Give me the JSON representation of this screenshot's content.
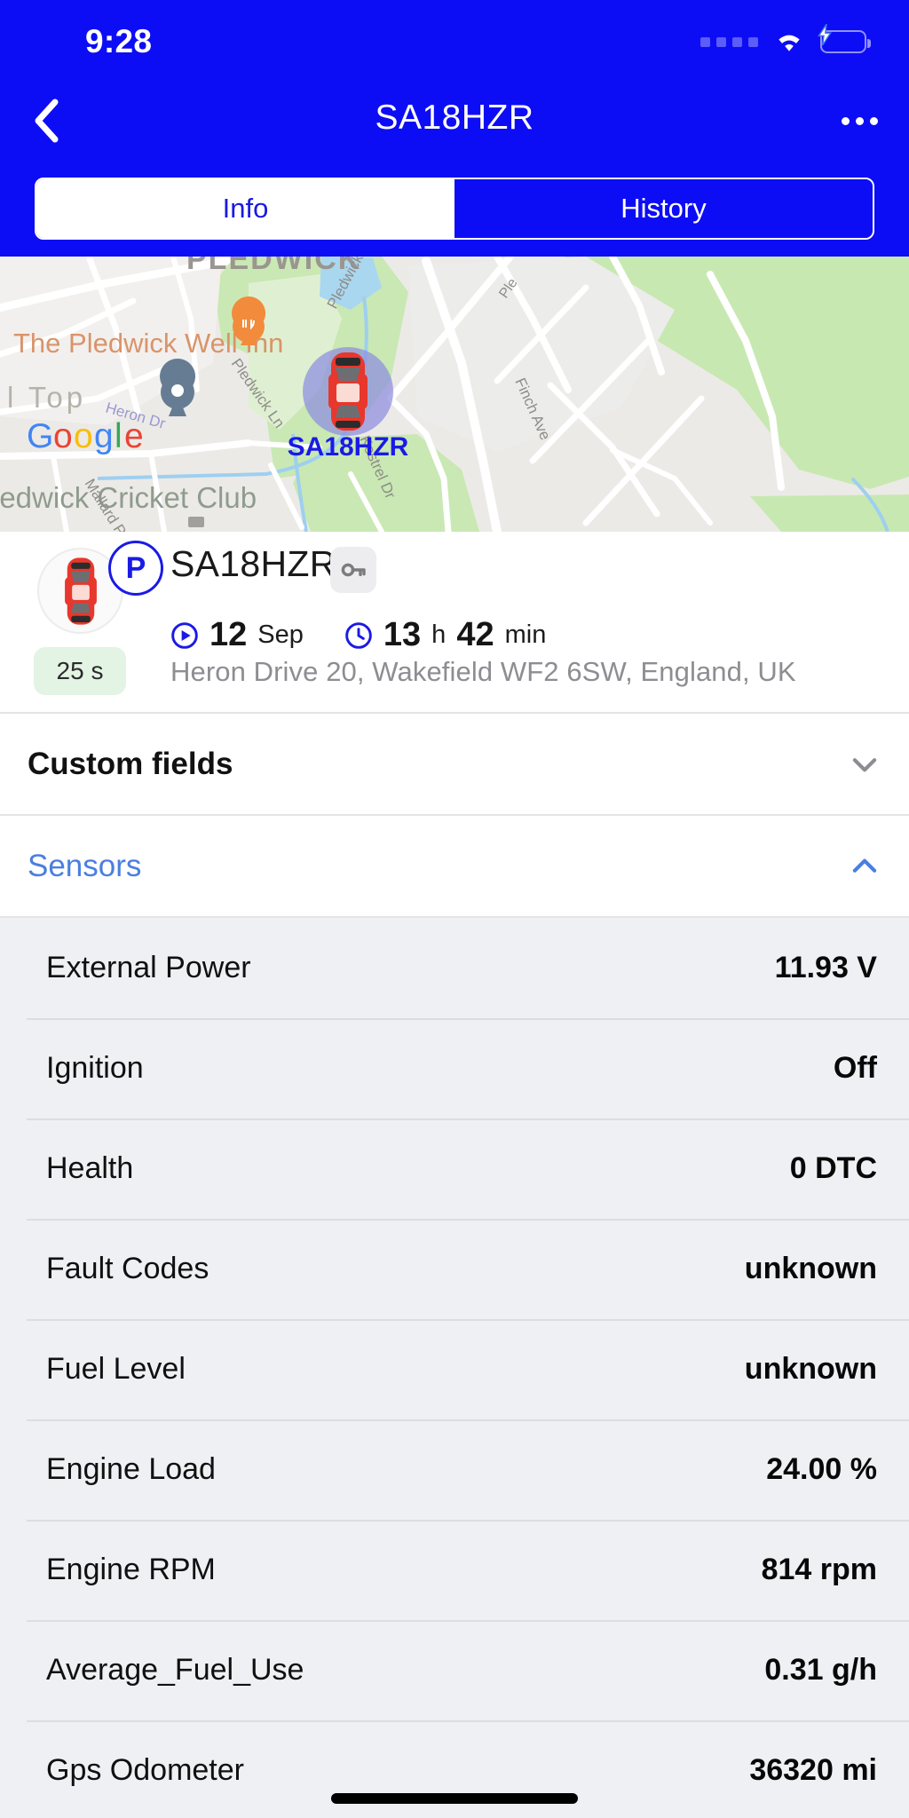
{
  "statusbar": {
    "time": "9:28",
    "signal_icon": "signal-dots-icon",
    "wifi_icon": "wifi-icon",
    "battery_icon": "battery-charging-icon"
  },
  "header": {
    "back_icon": "chevron-left-icon",
    "title": "SA18HZR",
    "more_icon": "more-horizontal-icon",
    "accent_color": "#0d0df5"
  },
  "tabs": [
    {
      "label": "Info",
      "active": true
    },
    {
      "label": "History",
      "active": false
    }
  ],
  "map": {
    "provider_logo": "google-logo",
    "provider_name": "Google",
    "marker_label": "SA18HZR",
    "marker_icon": "car-top-view-icon",
    "poi": [
      {
        "name": "The Pledwick Well Inn",
        "icon": "restaurant-pin-icon"
      },
      {
        "name": "Pledwick Cricket Club",
        "icon": "place-pin-icon"
      }
    ],
    "labels": [
      "PLEDWICK",
      "The Pledwick Well Inn",
      "l Top",
      "ledwick Cricket Club"
    ],
    "streets": [
      "Pledwick Ln",
      "Pledwick Cres",
      "Pledwick Cl",
      "Kestrel Dr",
      "Finch Ave",
      "Mallard P",
      "Heron Dr"
    ]
  },
  "vehicle": {
    "avatar_icon": "car-top-view-icon",
    "status_badge": "P",
    "status_badge_name": "parking-badge",
    "name": "SA18HZR",
    "key_icon": "key-icon",
    "start_icon": "play-circle-icon",
    "date_value": "12",
    "date_unit": "Sep",
    "clock_icon": "clock-icon",
    "hours_value": "13",
    "hours_unit": "h",
    "minutes_value": "42",
    "minutes_unit": "min",
    "duration_badge": "25 s",
    "address": "Heron Drive 20, Wakefield WF2 6SW, England, UK"
  },
  "sections": [
    {
      "title": "Custom fields",
      "expanded": false,
      "chevron_icon": "chevron-down-icon",
      "style": "dark"
    },
    {
      "title": "Sensors",
      "expanded": true,
      "chevron_icon": "chevron-up-icon",
      "style": "blue"
    }
  ],
  "sensors": [
    {
      "label": "External Power",
      "value": "11.93 V"
    },
    {
      "label": "Ignition",
      "value": "Off"
    },
    {
      "label": "Health",
      "value": "0 DTC"
    },
    {
      "label": "Fault Codes",
      "value": "unknown"
    },
    {
      "label": "Fuel Level",
      "value": "unknown"
    },
    {
      "label": "Engine Load",
      "value": "24.00 %"
    },
    {
      "label": "Engine RPM",
      "value": "814 rpm"
    },
    {
      "label": "Average_Fuel_Use",
      "value": "0.31 g/h"
    },
    {
      "label": "Gps Odometer",
      "value": "36320 mi"
    }
  ]
}
